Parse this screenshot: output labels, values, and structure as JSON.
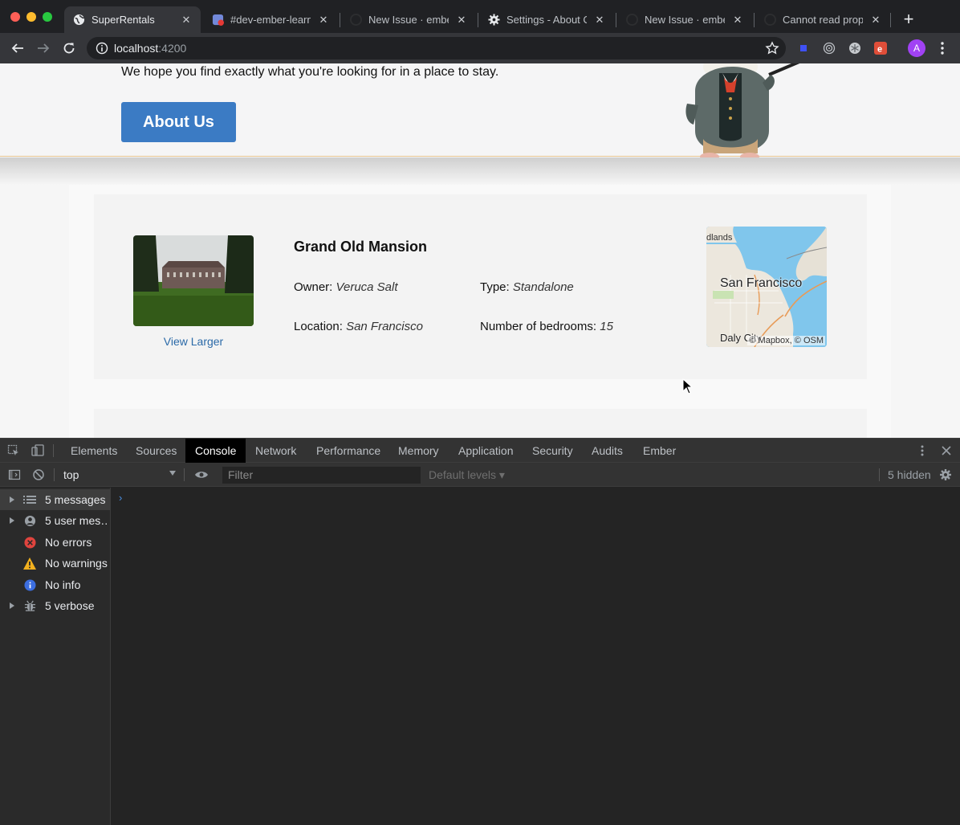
{
  "browser": {
    "tabs": [
      {
        "title": "SuperRentals",
        "icon": "globe-icon",
        "active": true
      },
      {
        "title": "#dev-ember-learnin",
        "icon": "discord-icon",
        "active": false
      },
      {
        "title": "New Issue · emberjs",
        "icon": "github-icon",
        "active": false
      },
      {
        "title": "Settings - About Chr",
        "icon": "gear-icon",
        "active": false
      },
      {
        "title": "New Issue · emberjs",
        "icon": "github-icon",
        "active": false
      },
      {
        "title": "Cannot read proper",
        "icon": "github-icon",
        "active": false
      }
    ],
    "url_host": "localhost",
    "url_port": ":4200",
    "avatar_letter": "A"
  },
  "page": {
    "lead": "We hope you find exactly what you're looking for in a place to stay.",
    "about_button": "About Us",
    "rental": {
      "title": "Grand Old Mansion",
      "owner_label": "Owner:",
      "owner": "Veruca Salt",
      "type_label": "Type:",
      "type": "Standalone",
      "location_label": "Location:",
      "location": "San Francisco",
      "bedrooms_label": "Number of bedrooms:",
      "bedrooms": "15",
      "view_larger": "View Larger",
      "map_city": "San Francisco",
      "map_city2": "Daly City",
      "map_attribution": "© Mapbox, © OSM",
      "map_partial_label": "dlands"
    }
  },
  "devtools": {
    "tabs": [
      "Elements",
      "Sources",
      "Console",
      "Network",
      "Performance",
      "Memory",
      "Application",
      "Security",
      "Audits",
      "Ember"
    ],
    "active_tab": "Console",
    "context": "top",
    "filter_placeholder": "Filter",
    "levels": "Default levels ▾",
    "hidden": "5 hidden",
    "sidebar": [
      {
        "label": "5 messages",
        "icon": "list-icon",
        "expandable": true
      },
      {
        "label": "5 user mes…",
        "icon": "user-icon",
        "expandable": true
      },
      {
        "label": "No errors",
        "icon": "error-icon",
        "expandable": false
      },
      {
        "label": "No warnings",
        "icon": "warning-icon",
        "expandable": false
      },
      {
        "label": "No info",
        "icon": "info-icon",
        "expandable": false
      },
      {
        "label": "5 verbose",
        "icon": "bug-icon",
        "expandable": true
      }
    ],
    "prompt": "›"
  },
  "colors": {
    "accent_button": "#3b7bc4",
    "link": "#2b6aa8",
    "devtools_bg": "#242424",
    "error": "#e0443e",
    "warning": "#f2b01e",
    "info": "#3c6ee0"
  }
}
